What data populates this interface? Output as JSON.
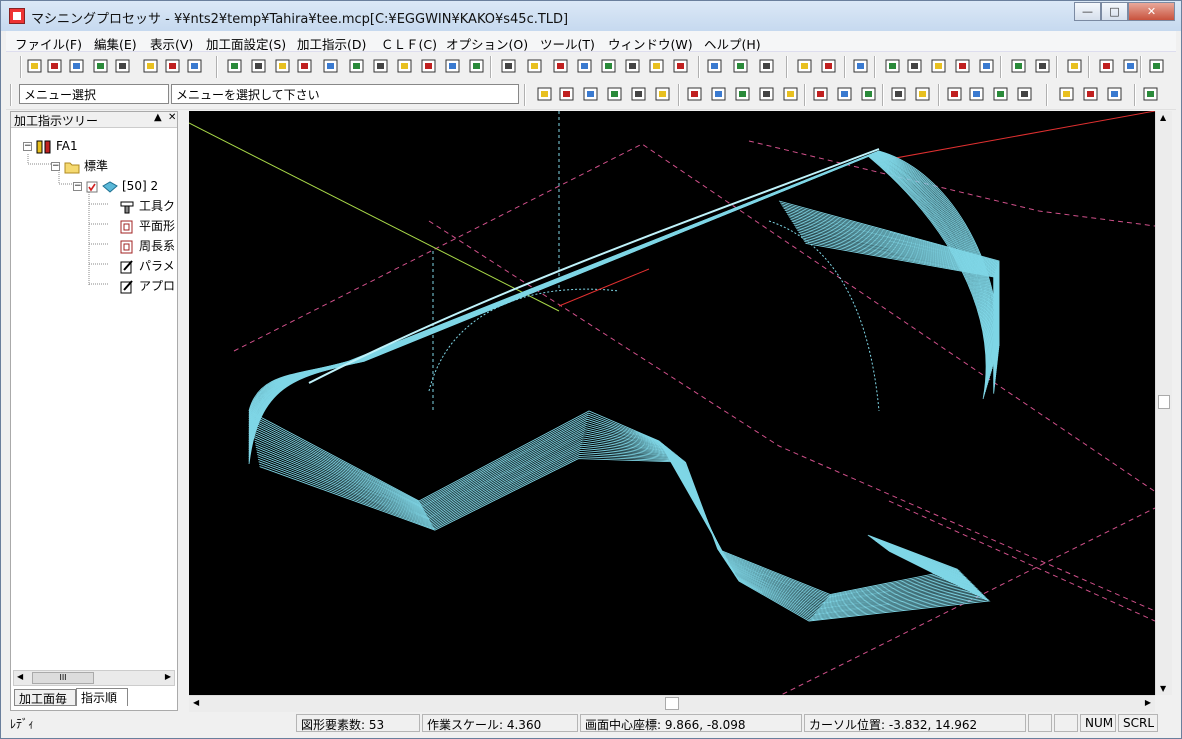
{
  "window": {
    "title": "マシニングプロセッサ - ¥¥nts2¥temp¥Tahira¥tee.mcp[C:¥EGGWIN¥KAKO¥s45c.TLD]",
    "controls": {
      "minimize": "—",
      "maximize": "□",
      "close": "✕"
    }
  },
  "menu": [
    "ファイル(F)",
    "編集(E)",
    "表示(V)",
    "加工面設定(S)",
    "加工指示(D)",
    "ＣＬＦ(C)",
    "オプション(O)",
    "ツール(T)",
    "ウィンドウ(W)",
    "ヘルプ(H)"
  ],
  "toolbar": {
    "mode_field": "メニュー選択",
    "message_field": "メニューを選択して下さい"
  },
  "tree_panel": {
    "title": "加工指示ツリー",
    "pin": "▲",
    "close": "✕",
    "nodes": [
      {
        "label": "FA1",
        "icon": "machine-icon"
      },
      {
        "label": "標準",
        "icon": "folder-icon"
      },
      {
        "label": "[50] 2",
        "icon": "surface-icon"
      },
      {
        "label": "工具ク",
        "icon": "tool-icon"
      },
      {
        "label": "平面形",
        "icon": "plane-icon"
      },
      {
        "label": "周長系",
        "icon": "contour-icon"
      },
      {
        "label": "パラメ",
        "icon": "param-icon"
      },
      {
        "label": "アプロ",
        "icon": "approach-icon"
      }
    ],
    "scroll_thumb": "III",
    "tabs": [
      "加工面毎",
      "指示順"
    ]
  },
  "status": {
    "ready": "ﾚﾃﾞｨ",
    "elements": "図形要素数: 53",
    "scale": "作業スケール:     4.360",
    "center": "画面中心座標:     9.866,    -8.098",
    "cursor": "カーソル位置:     -3.832,    14.962",
    "num": "NUM",
    "scrl": "SCRL"
  },
  "colors": {
    "mesh": "#7fd6e6",
    "dashed": "#d0508a",
    "axis_x": "#e03030",
    "axis_green": "#a8d848",
    "viewport_bg": "#000000"
  }
}
